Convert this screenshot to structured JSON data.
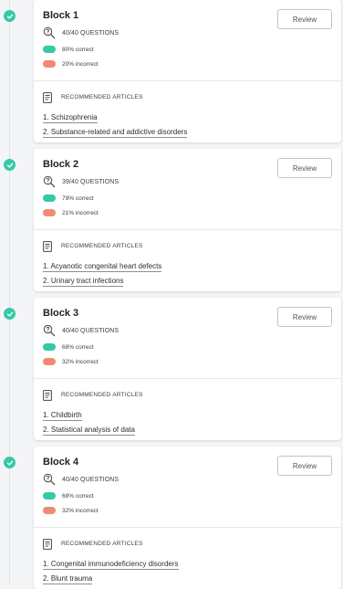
{
  "review_label": "Review",
  "recommended_label": "RECOMMENDED ARTICLES",
  "colors": {
    "correct": "#35c9a7",
    "incorrect": "#f08975",
    "check": "#35c9a7"
  },
  "blocks": [
    {
      "title": "Block 1",
      "questions": "40/40 QUESTIONS",
      "correct": "80% correct",
      "incorrect": "20% incorrect",
      "articles": [
        "1. Schizophrenia",
        "2. Substance-related and addictive disorders"
      ]
    },
    {
      "title": "Block 2",
      "questions": "39/40 QUESTIONS",
      "correct": "79% correct",
      "incorrect": "21% incorrect",
      "articles": [
        "1. Acyanotic congenital heart defects",
        "2. Urinary tract infections"
      ]
    },
    {
      "title": "Block 3",
      "questions": "40/40 QUESTIONS",
      "correct": "68% correct",
      "incorrect": "32% incorrect",
      "articles": [
        "1. Childbirth",
        "2. Statistical analysis of data"
      ]
    },
    {
      "title": "Block 4",
      "questions": "40/40 QUESTIONS",
      "correct": "68% correct",
      "incorrect": "32% incorrect",
      "articles": [
        "1. Congenital immunodeficiency disorders",
        "2. Blunt trauma"
      ]
    }
  ]
}
